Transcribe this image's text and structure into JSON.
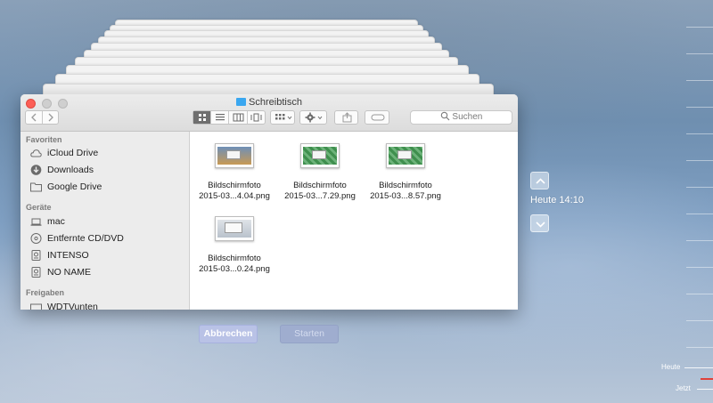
{
  "window": {
    "title": "Schreibtisch"
  },
  "toolbar": {
    "search_placeholder": "Suchen"
  },
  "sidebar": {
    "sections": [
      {
        "header": "Favoriten",
        "items": [
          {
            "label": "iCloud Drive",
            "icon": "cloud-icon"
          },
          {
            "label": "Downloads",
            "icon": "download-icon"
          },
          {
            "label": "Google Drive",
            "icon": "folder-icon"
          }
        ]
      },
      {
        "header": "Geräte",
        "items": [
          {
            "label": "mac",
            "icon": "laptop-icon"
          },
          {
            "label": "Entfernte CD/DVD",
            "icon": "disc-icon"
          },
          {
            "label": "INTENSO",
            "icon": "drive-icon"
          },
          {
            "label": "NO NAME",
            "icon": "drive-icon"
          }
        ]
      },
      {
        "header": "Freigaben",
        "items": [
          {
            "label": "WDTVunten",
            "icon": "network-drive-icon"
          }
        ]
      }
    ]
  },
  "files": [
    {
      "line1": "Bildschirmfoto",
      "line2": "2015-03...4.04.png",
      "thumb_color": "#c89a55"
    },
    {
      "line1": "Bildschirmfoto",
      "line2": "2015-03...7.29.png",
      "thumb_color": "#3f8f4e"
    },
    {
      "line1": "Bildschirmfoto",
      "line2": "2015-03...8.57.png",
      "thumb_color": "#3f8f4e"
    },
    {
      "line1": "Bildschirmfoto",
      "line2": "2015-03...0.24.png",
      "thumb_color": "#cfd5dc"
    }
  ],
  "actions": {
    "cancel_label": "Abbrechen",
    "start_label": "Starten"
  },
  "timeline": {
    "current_time": "Heute 14:10",
    "today_label": "Heute",
    "now_label": "Jetzt"
  },
  "colors": {
    "accent_red": "#e0413a",
    "folder_blue": "#3aa7f0"
  }
}
